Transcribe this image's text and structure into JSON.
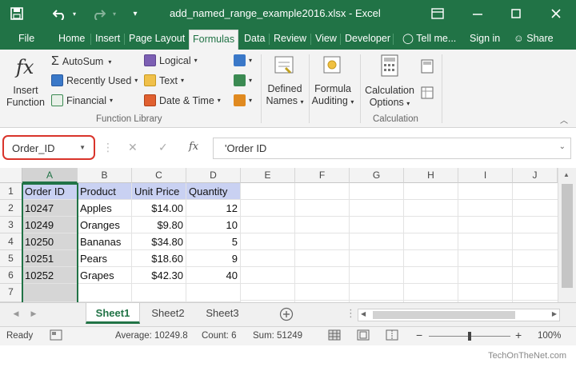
{
  "window": {
    "title": "add_named_range_example2016.xlsx - Excel",
    "signin_label": "Sign in",
    "share_label": "Share",
    "tell_me_label": "Tell me..."
  },
  "tabs": [
    {
      "label": "File"
    },
    {
      "label": "Home"
    },
    {
      "label": "Insert"
    },
    {
      "label": "Page Layout"
    },
    {
      "label": "Formulas"
    },
    {
      "label": "Data"
    },
    {
      "label": "Review"
    },
    {
      "label": "View"
    },
    {
      "label": "Developer"
    }
  ],
  "ribbon": {
    "insert_function": [
      "Insert",
      "Function"
    ],
    "autosum": "AutoSum",
    "recently_used": "Recently Used",
    "financial": "Financial",
    "logical": "Logical",
    "text": "Text",
    "date_time": "Date & Time",
    "defined_names": [
      "Defined",
      "Names"
    ],
    "formula_auditing": [
      "Formula",
      "Auditing"
    ],
    "calculation_options": [
      "Calculation",
      "Options"
    ],
    "group_function_library": "Function Library",
    "group_calculation": "Calculation"
  },
  "formula_bar": {
    "name_box": "Order_ID",
    "formula": "'Order ID",
    "fx": "fx"
  },
  "grid": {
    "columns": [
      "A",
      "B",
      "C",
      "D",
      "E",
      "F",
      "G",
      "H",
      "I",
      "J"
    ],
    "rows": [
      "1",
      "2",
      "3",
      "4",
      "5",
      "6",
      "7"
    ],
    "header": [
      "Order ID",
      "Product",
      "Unit Price",
      "Quantity"
    ],
    "data": [
      [
        "10247",
        "Apples",
        "$14.00",
        "12"
      ],
      [
        "10249",
        "Oranges",
        "$9.80",
        "10"
      ],
      [
        "10250",
        "Bananas",
        "$34.80",
        "5"
      ],
      [
        "10251",
        "Pears",
        "$18.60",
        "9"
      ],
      [
        "10252",
        "Grapes",
        "$42.30",
        "40"
      ]
    ]
  },
  "sheets": [
    {
      "label": "Sheet1"
    },
    {
      "label": "Sheet2"
    },
    {
      "label": "Sheet3"
    }
  ],
  "status": {
    "ready": "Ready",
    "average": "Average: 10249.8",
    "count": "Count: 6",
    "sum": "Sum: 51249",
    "zoom": "100%"
  },
  "watermark": "TechOnTheNet.com",
  "colors": {
    "brand": "#217346",
    "header_fill": "#c9d1f2",
    "name_box_highlight": "#d9342b"
  },
  "icons": [
    "save-icon",
    "undo-icon",
    "redo-icon",
    "ribbon-display-icon",
    "minimize-icon",
    "maximize-icon",
    "close-icon",
    "lightbulb-icon",
    "share-user-icon"
  ]
}
